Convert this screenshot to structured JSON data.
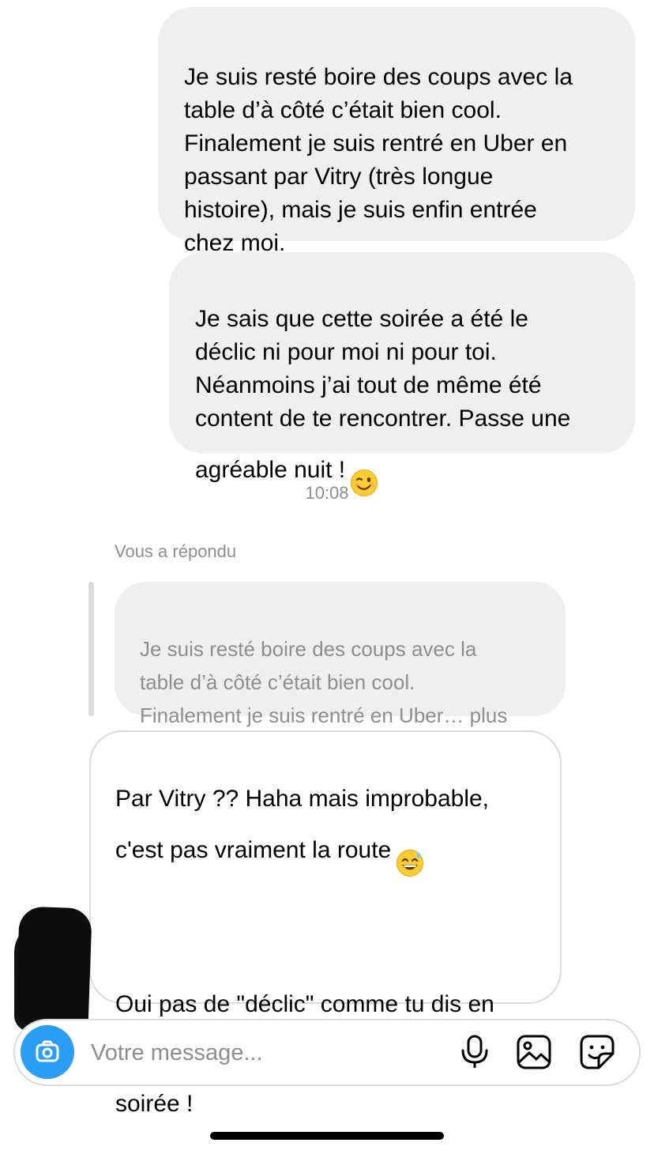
{
  "messages": {
    "sent_1": "Je suis resté boire des coups avec la\ntable d’à côté c’était bien cool.\nFinalement je suis rentré en Uber en\npassant par Vitry (très longue\nhistoire), mais je suis enfin entrée\nchez moi.",
    "sent_2": "Je sais que cette soirée a été le\ndéclic ni pour moi ni pour toi.\nNéanmoins j’ai tout de même été\ncontent de te rencontrer. Passe une\nagréable nuit !",
    "sent_2_emoji": "😉",
    "timestamp": "10:08",
    "reply_label": "Vous a répondu",
    "quoted_text": "Je suis resté boire des coups avec la\ntable d’à côté c’était bien cool.\nFinalement je suis rentré en Uber… plus",
    "received_p1": "Par Vitry ?? Haha mais improbable,\nc'est pas vraiment la route",
    "received_p1_emoji": "😅",
    "received_p2": "Oui pas de \"déclic\" comme tu dis en\neffet mais ça m'a fait plaisir aussi de\nte rencontrer, c'était une bonne\nsoirée !"
  },
  "composer": {
    "placeholder": "Votre message...",
    "icons": [
      "camera-icon",
      "microphone-icon",
      "image-icon",
      "sticker-icon"
    ]
  },
  "colors": {
    "sent_bubble": "#efefef",
    "received_border": "#dbdbdb",
    "meta_text": "#8e8e8e",
    "camera_button": "#2a9df4"
  }
}
